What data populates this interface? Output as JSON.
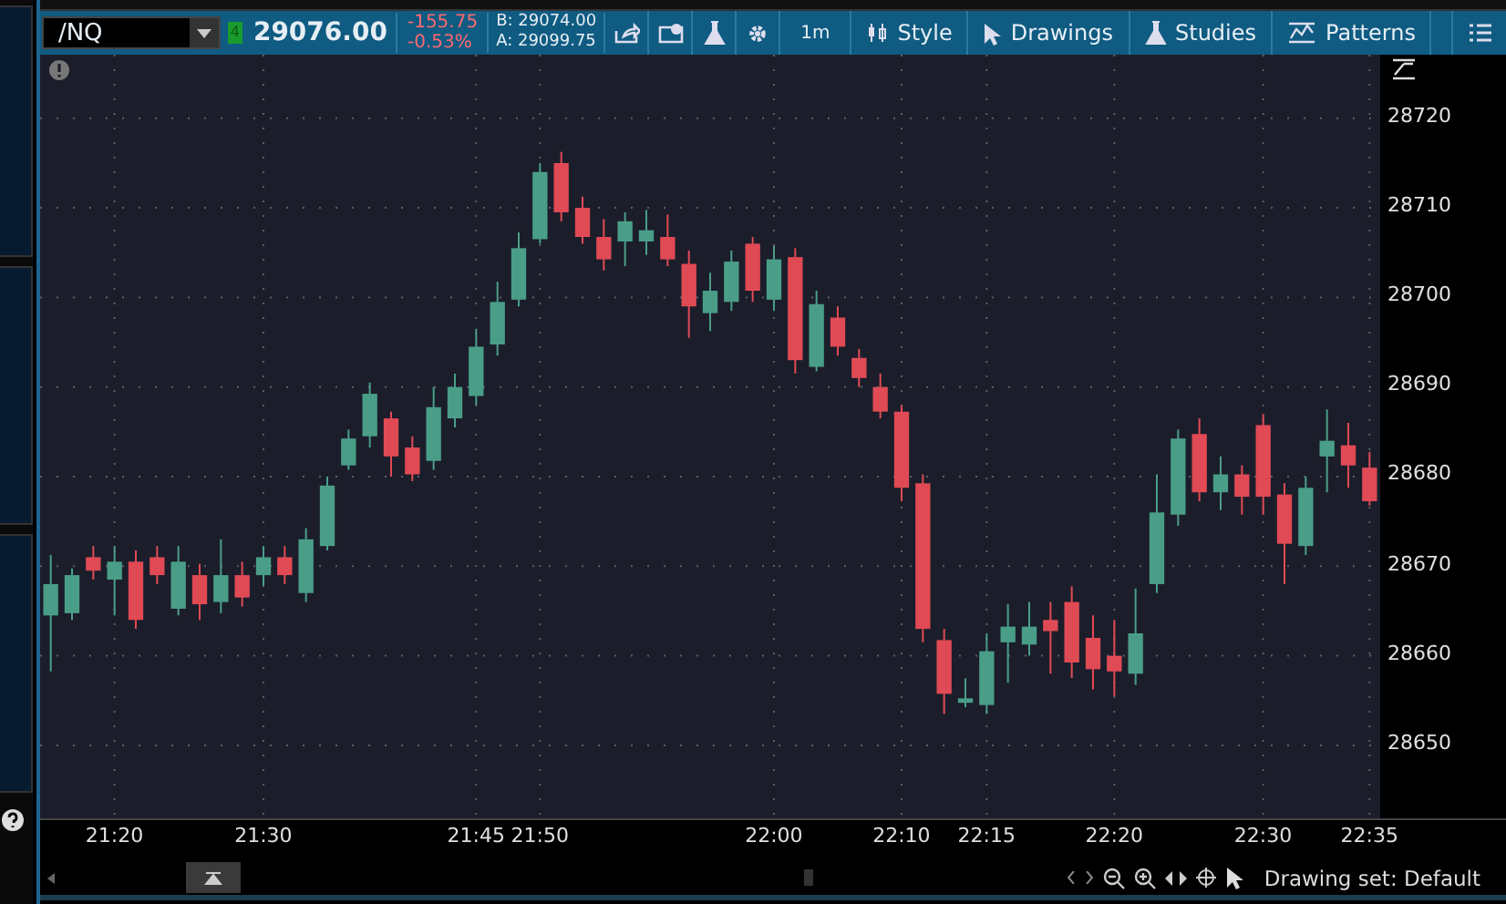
{
  "toolbar": {
    "symbol": "/NQ",
    "indicator": "4",
    "last_price": "29076.00",
    "change": "-155.75",
    "change_percent": "-0.53%",
    "bid": "B: 29074.00",
    "ask": "A: 29099.75",
    "aggregation": "1m",
    "buttons": [
      {
        "label": "Style",
        "kind": "style"
      },
      {
        "label": "Drawings",
        "kind": "drawings"
      },
      {
        "label": "Studies",
        "kind": "studies"
      },
      {
        "label": "Patterns",
        "kind": "patterns"
      }
    ]
  },
  "chart": {
    "chart_data": {
      "type": "candlestick",
      "categories": [
        null,
        null,
        null,
        "21:20",
        null,
        null,
        null,
        null,
        null,
        null,
        "21:30",
        null,
        null,
        null,
        null,
        null,
        null,
        null,
        null,
        null,
        "21:45",
        null,
        null,
        "21:50",
        null,
        null,
        null,
        null,
        null,
        null,
        null,
        null,
        null,
        null,
        "22:00",
        null,
        null,
        null,
        null,
        null,
        "22:10",
        null,
        null,
        null,
        "22:15",
        null,
        null,
        null,
        null,
        null,
        "22:20",
        null,
        null,
        null,
        null,
        null,
        null,
        "22:30",
        null,
        null,
        null,
        null,
        "22:35"
      ],
      "grid": true,
      "ylim": [
        28641.85,
        28727.1
      ],
      "ohlc": [
        [
          28664.5,
          28671.25,
          28658.25,
          28668
        ],
        [
          28664.75,
          28669.75,
          28664,
          28669
        ],
        [
          28671,
          28672.25,
          28668.5,
          28669.5
        ],
        [
          28668.5,
          28672.25,
          28664.5,
          28670.5
        ],
        [
          28670.5,
          28671.75,
          28663,
          28664
        ],
        [
          28671,
          28672.25,
          28668,
          28669
        ],
        [
          28665.25,
          28672.25,
          28664.5,
          28670.5
        ],
        [
          28669,
          28670.25,
          28664,
          28665.75
        ],
        [
          28666,
          28673,
          28664.75,
          28669
        ],
        [
          28669,
          28670.5,
          28665.5,
          28666.5
        ],
        [
          28669,
          28672.25,
          28667.75,
          28671
        ],
        [
          28671,
          28672.25,
          28668,
          28669
        ],
        [
          28667,
          28674.25,
          28666,
          28673
        ],
        [
          28672.25,
          28680,
          28671.75,
          28679
        ],
        [
          28681.25,
          28685.25,
          28680.75,
          28684.25
        ],
        [
          28684.5,
          28690.5,
          28683.25,
          28689.25
        ],
        [
          28686.5,
          28687.25,
          28680,
          28682.25
        ],
        [
          28683.25,
          28684.5,
          28679.5,
          28680.25
        ],
        [
          28681.75,
          28690,
          28680.75,
          28687.75
        ],
        [
          28686.5,
          28691.5,
          28685.5,
          28690
        ],
        [
          28689,
          28696.5,
          28688,
          28694.5
        ],
        [
          28694.75,
          28701.75,
          28693.5,
          28699.5
        ],
        [
          28699.75,
          28707.25,
          28699,
          28705.5
        ],
        [
          28706.5,
          28715,
          28706,
          28714
        ],
        [
          28715,
          28716.25,
          28708.5,
          28709.5
        ],
        [
          28710,
          28711.25,
          28706,
          28706.75
        ],
        [
          28706.75,
          28708.75,
          28703,
          28704.25
        ],
        [
          28706.25,
          28709.5,
          28703.5,
          28708.5
        ],
        [
          28706.25,
          28709.75,
          28704.75,
          28707.5
        ],
        [
          28706.75,
          28709.25,
          28703.5,
          28704.25
        ],
        [
          28703.75,
          28705.25,
          28695.5,
          28699
        ],
        [
          28698.25,
          28702.75,
          28696.25,
          28700.75
        ],
        [
          28699.5,
          28705.25,
          28698.5,
          28704
        ],
        [
          28706,
          28706.75,
          28699.5,
          28700.75
        ],
        [
          28699.75,
          28705.75,
          28698.5,
          28704.25
        ],
        [
          28704.5,
          28705.5,
          28691.5,
          28693
        ],
        [
          28692.25,
          28700.75,
          28691.75,
          28699.25
        ],
        [
          28697.75,
          28699,
          28693.5,
          28694.5
        ],
        [
          28693.25,
          28694.25,
          28690,
          28691
        ],
        [
          28690,
          28691.5,
          28686.5,
          28687.25
        ],
        [
          28687.25,
          28688,
          28677.25,
          28678.75
        ],
        [
          28679.25,
          28680.25,
          28661.5,
          28663
        ],
        [
          28661.75,
          28663,
          28653.5,
          28655.75
        ],
        [
          28654.75,
          28657.5,
          28654.25,
          28655.25
        ],
        [
          28654.5,
          28662.5,
          28653.5,
          28660.5
        ],
        [
          28661.5,
          28665.75,
          28657,
          28663.25
        ],
        [
          28661.25,
          28666,
          28660,
          28663.25
        ],
        [
          28664,
          28666,
          28658,
          28662.75
        ],
        [
          28666,
          28667.75,
          28657.5,
          28659.25
        ],
        [
          28662,
          28664.5,
          28656.25,
          28658.5
        ],
        [
          28660,
          28664,
          28655.5,
          28658.25
        ],
        [
          28658,
          28667.5,
          28656.75,
          28662.5
        ],
        [
          28668,
          28680.25,
          28667,
          28676
        ],
        [
          28675.75,
          28685.25,
          28674.5,
          28684.25
        ],
        [
          28684.75,
          28686.5,
          28677.25,
          28678.25
        ],
        [
          28678.25,
          28682.25,
          28676.25,
          28680.25
        ],
        [
          28680.25,
          28681.25,
          28675.75,
          28677.75
        ],
        [
          28685.75,
          28687,
          28675.75,
          28677.75
        ],
        [
          28678,
          28679.25,
          28668,
          28672.5
        ],
        [
          28672.25,
          28680,
          28671.25,
          28678.75
        ],
        [
          28682.25,
          28687.5,
          28678.25,
          28684
        ],
        [
          28683.5,
          28686,
          28678.75,
          28681.25
        ],
        [
          28681,
          28682.75,
          28676.75,
          28677.25
        ]
      ],
      "yticks": [
        28720,
        28710,
        28700,
        28690,
        28680,
        28670,
        28660,
        28650
      ]
    }
  },
  "footer": {
    "drawing_set": "Drawing set: Default"
  }
}
